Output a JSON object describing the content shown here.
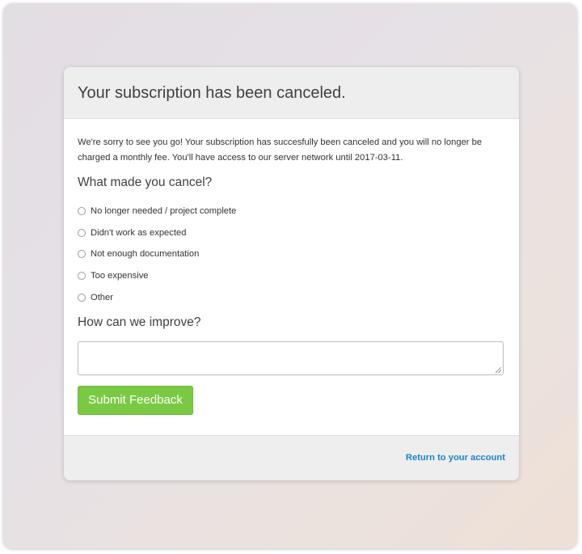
{
  "header": {
    "title": "Your subscription has been canceled."
  },
  "body": {
    "intro": "We're sorry to see you go! Your subscription has succesfully been canceled and you will no longer be charged a monthly fee. You'll have access to our server network until 2017-03-11.",
    "reason_question": "What made you cancel?",
    "reasons": [
      "No longer needed / project complete",
      "Didn't work as expected",
      "Not enough documentation",
      "Too expensive",
      "Other"
    ],
    "improve_question": "How can we improve?",
    "feedback_value": "",
    "submit_label": "Submit Feedback"
  },
  "footer": {
    "return_link": "Return to your account"
  },
  "colors": {
    "accent_green": "#7ac943",
    "link_blue": "#1a84c6"
  }
}
